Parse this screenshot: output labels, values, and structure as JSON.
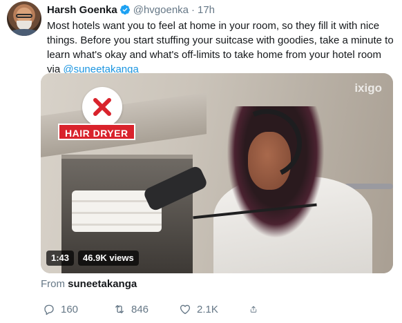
{
  "tweet": {
    "author_name": "Harsh Goenka",
    "handle": "@hvgoenka",
    "separator": "·",
    "time": "17h",
    "text_before": "Most hotels want you to feel at home in your room, so they fill it with nice things. Before you start stuffing your suitcase with goodies, take a minute to learn what's okay and what's off-limits to take home from your hotel room via ",
    "mention": "@suneetakanga"
  },
  "media": {
    "overlay_label": "HAIR DRYER",
    "watermark": "ixigo",
    "duration": "1:43",
    "views": "46.9K views"
  },
  "source": {
    "prefix": "From ",
    "name": "suneetakanga"
  },
  "actions": {
    "replies": "160",
    "retweets": "846",
    "likes": "2.1K"
  },
  "colors": {
    "link": "#1b95e0",
    "muted": "#657786",
    "verified": "#1da1f2",
    "label_red": "#d9232c"
  }
}
